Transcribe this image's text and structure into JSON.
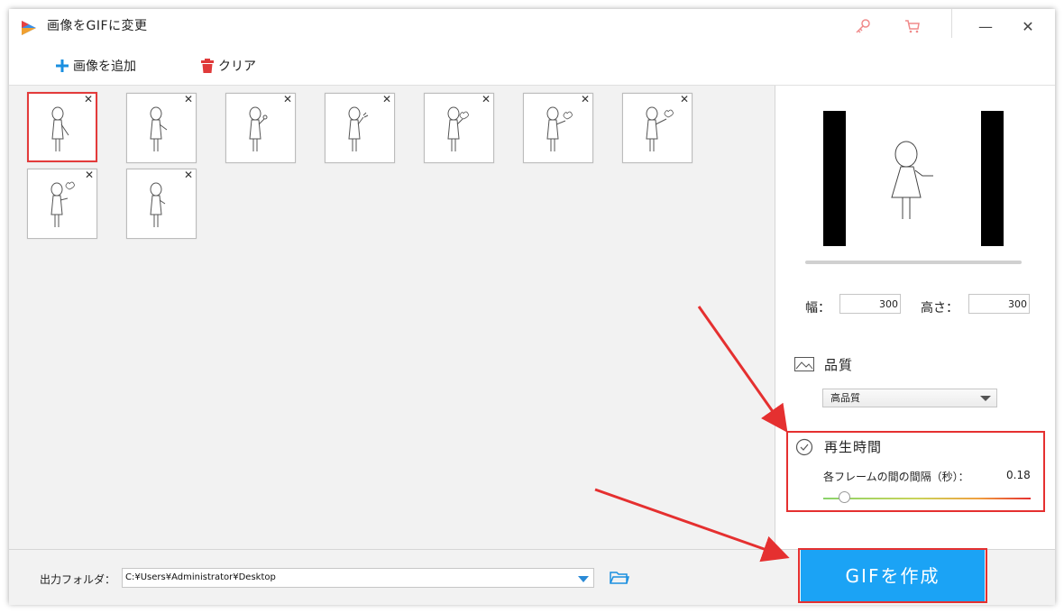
{
  "window": {
    "title": "画像をGIFに変更",
    "minimize": "—",
    "close": "✕"
  },
  "toolbar": {
    "add_label": "画像を追加",
    "clear_label": "クリア"
  },
  "thumbnails": [
    {
      "selected": true,
      "remove": "✕"
    },
    {
      "selected": false,
      "remove": "✕"
    },
    {
      "selected": false,
      "remove": "✕"
    },
    {
      "selected": false,
      "remove": "✕"
    },
    {
      "selected": false,
      "remove": "✕"
    },
    {
      "selected": false,
      "remove": "✕"
    },
    {
      "selected": false,
      "remove": "✕"
    },
    {
      "selected": false,
      "remove": "✕"
    },
    {
      "selected": false,
      "remove": "✕"
    }
  ],
  "settings": {
    "width_label": "幅：",
    "width_value": "300",
    "height_label": "高さ：",
    "height_value": "300",
    "quality_label": "品質",
    "quality_value": "高品質",
    "duration_label": "再生時間",
    "interval_label": "各フレームの間の間隔（秒）：",
    "interval_value": "0.18",
    "interval_slider_fraction": 0.1
  },
  "output": {
    "folder_label": "出力フォルダ：",
    "folder_path": "C:¥Users¥Administrator¥Desktop"
  },
  "create_button": "GIFを作成",
  "colors": {
    "accent": "#1ba3f5",
    "highlight": "#e53030",
    "selected_border": "#e33b3b"
  }
}
